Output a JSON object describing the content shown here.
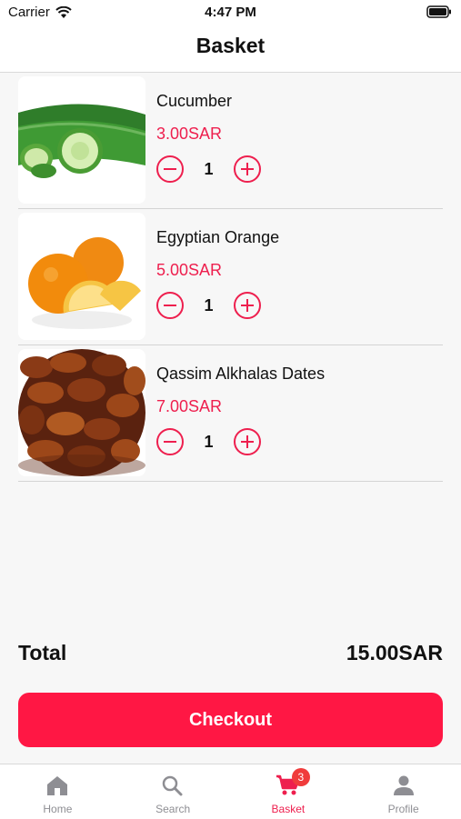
{
  "status_bar": {
    "carrier": "Carrier",
    "time": "4:47 PM"
  },
  "nav": {
    "title": "Basket"
  },
  "items": [
    {
      "name": "Cucumber",
      "price": "3.00SAR",
      "quantity": "1",
      "image": "cucumber-image"
    },
    {
      "name": "Egyptian Orange",
      "price": "5.00SAR",
      "quantity": "1",
      "image": "orange-image"
    },
    {
      "name": "Qassim Alkhalas Dates",
      "price": "7.00SAR",
      "quantity": "1",
      "image": "dates-image"
    }
  ],
  "summary": {
    "total_label": "Total",
    "total_value": "15.00SAR"
  },
  "checkout_label": "Checkout",
  "tabs": [
    {
      "label": "Home",
      "icon": "home-icon"
    },
    {
      "label": "Search",
      "icon": "search-icon"
    },
    {
      "label": "Basket",
      "icon": "cart-icon",
      "badge": "3"
    },
    {
      "label": "Profile",
      "icon": "profile-icon"
    }
  ],
  "colors": {
    "accent": "#ee1f4e",
    "button": "#ff1744",
    "inactive": "#8e8e93",
    "badge": "#f03c3c"
  }
}
